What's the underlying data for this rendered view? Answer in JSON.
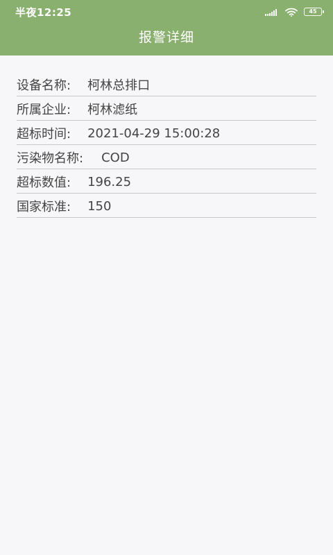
{
  "status_bar": {
    "time": "半夜12:25",
    "signal_icon": "signal-bars-icon",
    "wifi_icon": "wifi-icon",
    "battery_level": "45"
  },
  "header": {
    "title": "报警详细",
    "background": "#89b06e"
  },
  "details": [
    {
      "label": "设备名称:",
      "value": "柯林总排口"
    },
    {
      "label": "所属企业:",
      "value": "柯林滤纸"
    },
    {
      "label": "超标时间:",
      "value": "2021-04-29 15:00:28"
    },
    {
      "label": "污染物名称:",
      "value": "COD"
    },
    {
      "label": "超标数值:",
      "value": "196.25"
    },
    {
      "label": "国家标准:",
      "value": "150"
    }
  ]
}
